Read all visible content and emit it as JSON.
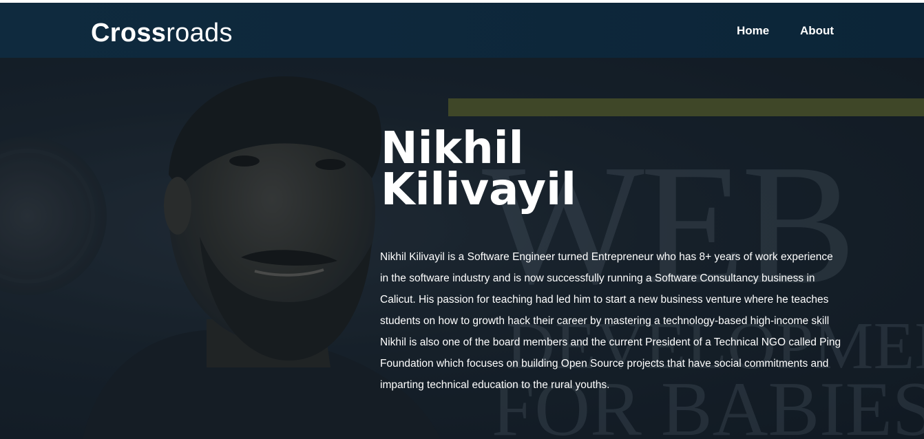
{
  "navbar": {
    "brand_bold": "Cross",
    "brand_light": "roads",
    "links": [
      "Home",
      "About"
    ]
  },
  "hero": {
    "name_line1": "Nikhil",
    "name_line2": "Kilivayil",
    "bio": "Nikhil Kilivayil is a Software Engineer turned Entrepreneur who has 8+ years of work experience in the software industry and is now successfully running a Software Consultancy business in Calicut. His passion for teaching had led him to start a new business venture where he teaches students on how to growth hack their career by mastering a technology-based high-income skill Nikhil is also one of the board members and the current President of a Technical NGO called Ping Foundation which focuses on building Open Source projects that have social commitments and imparting technical education to the rural youths.",
    "background_text": {
      "line1": "WEB",
      "line2": "DEVELOPMENT",
      "line3": "FOR BABIES"
    }
  },
  "colors": {
    "navbar": "#0f2a3e",
    "accent_bar": "#3f4728",
    "text": "#ffffff"
  }
}
